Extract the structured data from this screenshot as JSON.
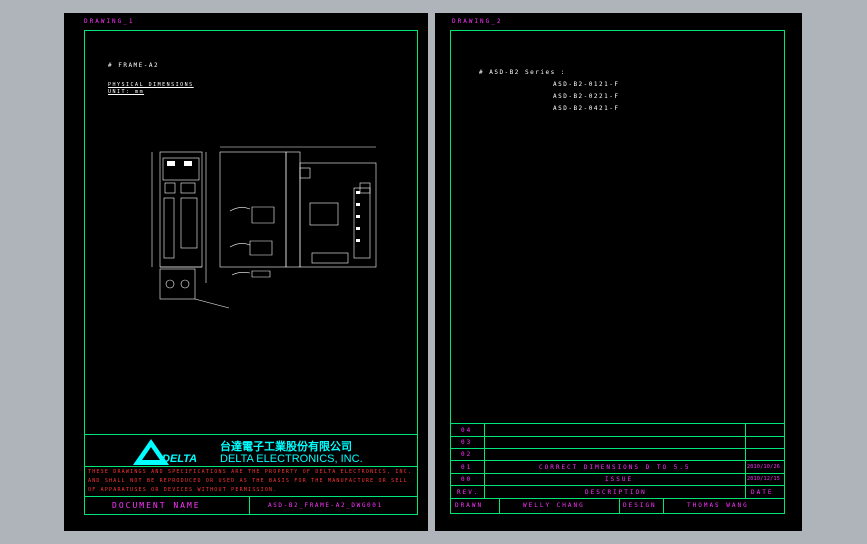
{
  "left_sheet": {
    "header": "DRAWING_1",
    "frame_label": "# FRAME-A2",
    "physical_dims": "PHYSICAL DIMENSIONS",
    "unit": "UNIT: mm",
    "company_cn": "台達電子工業股份有限公司",
    "company_en": "DELTA ELECTRONICS, INC.",
    "logo_text": "DELTA",
    "disclaimer_1": "THESE DRAWINGS AND SPECIFICATIONS ARE THE PROPERTY OF DELTA ELECTRONICS, INC.",
    "disclaimer_2": "AND SHALL NOT BE REPRODUCED OR USED AS THE BASIS FOR THE MANUFACTURE OR SELL",
    "disclaimer_3": "OF APPARATUSES OR DEVICES WITHOUT PERMISSION.",
    "doc_name_label": "DOCUMENT NAME",
    "doc_name_value": "ASD-B2_FRAME-A2_DWG001"
  },
  "right_sheet": {
    "header": "DRAWING_2",
    "series_title": "# ASD-B2 Series :",
    "models": [
      "ASD-B2-0121-F",
      "ASD-B2-0221-F",
      "ASD-B2-0421-F"
    ],
    "rev_rows": [
      {
        "rev": "04",
        "desc": "",
        "date": ""
      },
      {
        "rev": "03",
        "desc": "",
        "date": ""
      },
      {
        "rev": "02",
        "desc": "",
        "date": ""
      },
      {
        "rev": "01",
        "desc": "CORRECT DIMENSIONS D TO 5.5",
        "date": "2010/10/26"
      },
      {
        "rev": "00",
        "desc": "ISSUE",
        "date": "2010/12/15"
      }
    ],
    "rev_header": {
      "rev": "REV.",
      "desc": "DESCRIPTION",
      "date": "DATE"
    },
    "footer": {
      "drawn_label": "DRAWN",
      "drawn_value": "WELLY CHANG",
      "design_label": "DESIGN",
      "design_value": "THOMAS WANG"
    }
  },
  "colors": {
    "frame": "#00e676",
    "text": "#ff33ff",
    "accent": "#00ffff",
    "warning": "#ff3333"
  }
}
